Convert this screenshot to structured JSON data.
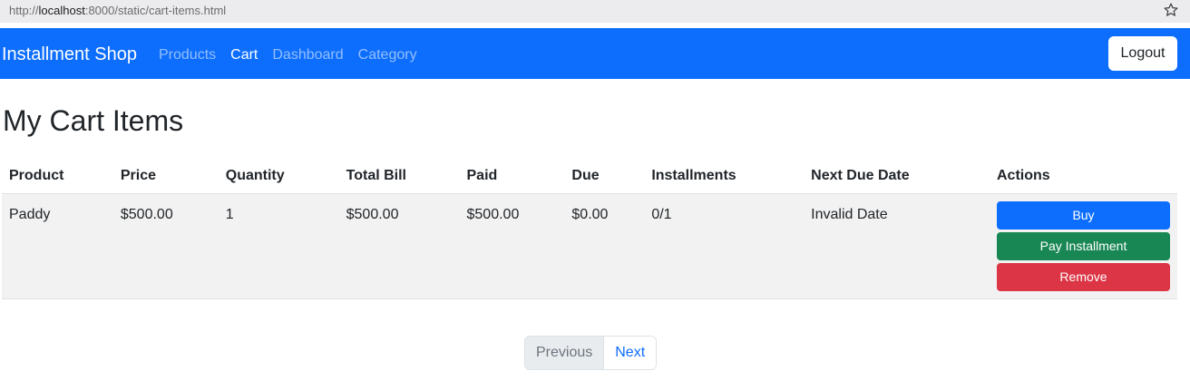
{
  "browser": {
    "url_scheme": "http://",
    "url_host": "localhost",
    "url_rest": ":8000/static/cart-items.html"
  },
  "navbar": {
    "brand": "Installment Shop",
    "links": [
      {
        "label": "Products",
        "active": false
      },
      {
        "label": "Cart",
        "active": true
      },
      {
        "label": "Dashboard",
        "active": false
      },
      {
        "label": "Category",
        "active": false
      }
    ],
    "logout_label": "Logout"
  },
  "page": {
    "title": "My Cart Items"
  },
  "table": {
    "columns": [
      "Product",
      "Price",
      "Quantity",
      "Total Bill",
      "Paid",
      "Due",
      "Installments",
      "Next Due Date",
      "Actions"
    ],
    "rows": [
      {
        "cells": [
          "Paddy",
          "$500.00",
          "1",
          "$500.00",
          "$500.00",
          "$0.00",
          "0/1",
          "Invalid Date"
        ],
        "actions": {
          "buy": "Buy",
          "pay": "Pay Installment",
          "remove": "Remove"
        }
      }
    ]
  },
  "pagination": {
    "previous": "Previous",
    "next": "Next"
  },
  "colors": {
    "primary": "#0d6efd",
    "success": "#198754",
    "danger": "#dc3545"
  }
}
